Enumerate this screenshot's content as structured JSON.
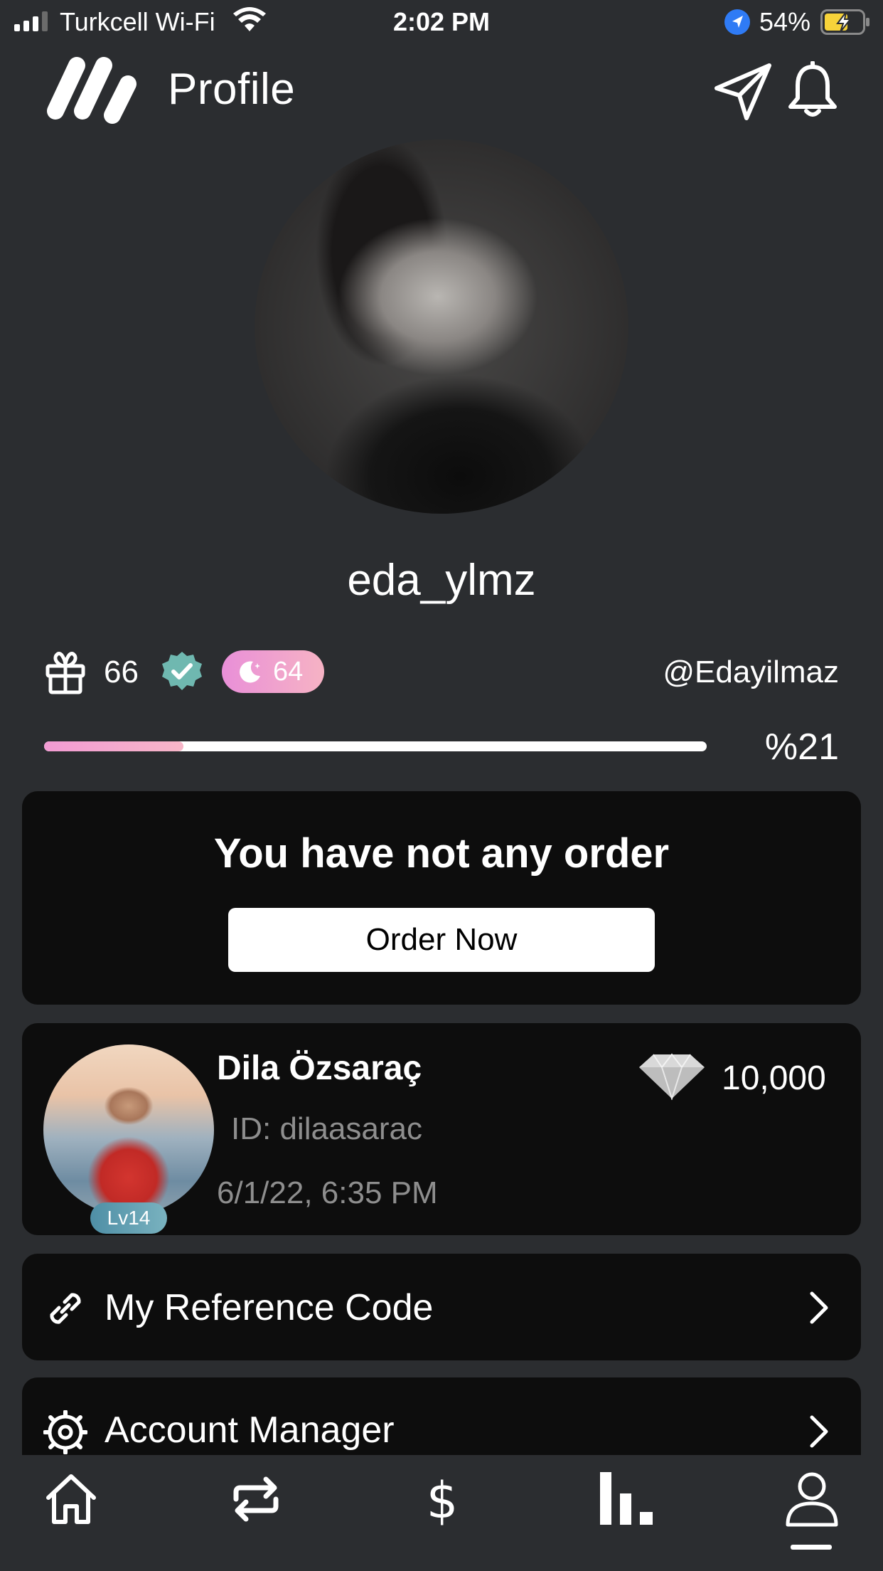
{
  "status_bar": {
    "carrier": "Turkcell Wi-Fi",
    "time": "2:02 PM",
    "battery": "54%"
  },
  "header": {
    "title": "Profile"
  },
  "profile": {
    "username": "eda_ylmz",
    "gift_count": "66",
    "moon_points": "64",
    "handle": "@Edayilmaz",
    "progress_label": "%21",
    "progress_fraction": 0.21
  },
  "order": {
    "message": "You have not any order",
    "button_label": "Order Now"
  },
  "user_card": {
    "name": "Dila Özsaraç",
    "id": "ID: dilaasarac",
    "date": "6/1/22, 6:35 PM",
    "level": "Lv14",
    "diamonds": "10,000"
  },
  "menu": {
    "reference_code": "My Reference Code",
    "account_manager": "Account Manager"
  },
  "tabs": [
    "home",
    "exchange",
    "dollar",
    "stats",
    "profile"
  ],
  "colors": {
    "background": "#2b2d30",
    "card": "#0d0d0d",
    "accent_pink": "#f29bd3",
    "verified_teal": "#6fb8b0",
    "location_blue": "#2f7bf5",
    "battery_yellow": "#f7d33a"
  }
}
